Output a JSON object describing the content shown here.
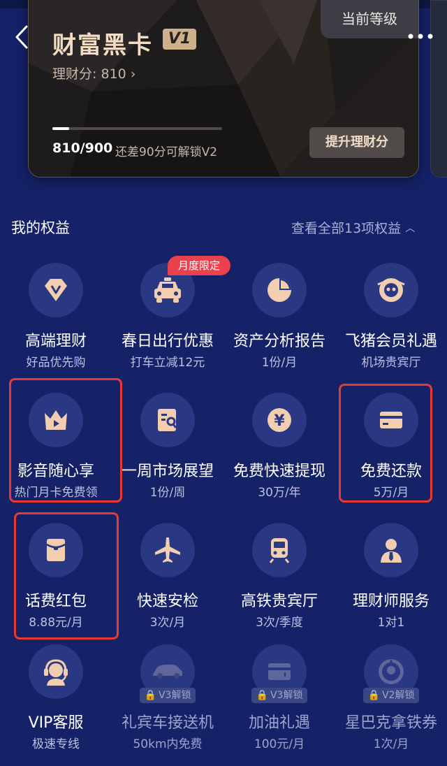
{
  "card": {
    "title": "财富黑卡",
    "level_badge": "V1",
    "score_label": "理财分: 810 ›",
    "current_level_label": "当前等级",
    "progress_text": "810/900",
    "progress_fraction": 0.1,
    "progress_hint": "还差90分可解锁V2",
    "upgrade_button": "提升理财分"
  },
  "section": {
    "title": "我的权益",
    "view_all": "查看全部13项权益"
  },
  "benefits": [
    {
      "title": "高端理财",
      "sub": "好品优先购",
      "icon": "diamond-icon"
    },
    {
      "title": "春日出行优惠",
      "sub": "打车立减12元",
      "icon": "taxi-icon",
      "tag": "月度限定"
    },
    {
      "title": "资产分析报告",
      "sub": "1份/月",
      "icon": "pie-chart-icon"
    },
    {
      "title": "飞猪会员礼遇",
      "sub": "机场贵宾厅",
      "icon": "fliggy-icon"
    },
    {
      "title": "影音随心享",
      "sub": "热门月卡免费领",
      "icon": "crown-play-icon"
    },
    {
      "title": "一周市场展望",
      "sub": "1份/周",
      "icon": "report-search-icon"
    },
    {
      "title": "免费快速提现",
      "sub": "30万/年",
      "icon": "yen-coin-icon"
    },
    {
      "title": "免费还款",
      "sub": "5万/月",
      "icon": "credit-card-icon"
    },
    {
      "title": "话费红包",
      "sub": "8.88元/月",
      "icon": "red-envelope-icon"
    },
    {
      "title": "快速安检",
      "sub": "3次/月",
      "icon": "airplane-icon"
    },
    {
      "title": "高铁贵宾厅",
      "sub": "3次/季度",
      "icon": "train-icon"
    },
    {
      "title": "理财师服务",
      "sub": "1对1",
      "icon": "advisor-icon"
    },
    {
      "title": "VIP客服",
      "sub": "极速专线",
      "icon": "headset-icon"
    },
    {
      "title": "礼宾车接送机",
      "sub": "50km内免费",
      "icon": "car-icon",
      "lock": "V3解锁"
    },
    {
      "title": "加油礼遇",
      "sub": "100元/月",
      "icon": "fuel-card-icon",
      "lock": "V3解锁"
    },
    {
      "title": "星巴克拿铁券",
      "sub": "1次/月",
      "icon": "starbucks-icon",
      "lock": "V2解锁"
    }
  ],
  "colors": {
    "background": "#152268",
    "accent": "#f2ceb0",
    "highlight": "#e83a32",
    "tag": "#e9424e"
  }
}
